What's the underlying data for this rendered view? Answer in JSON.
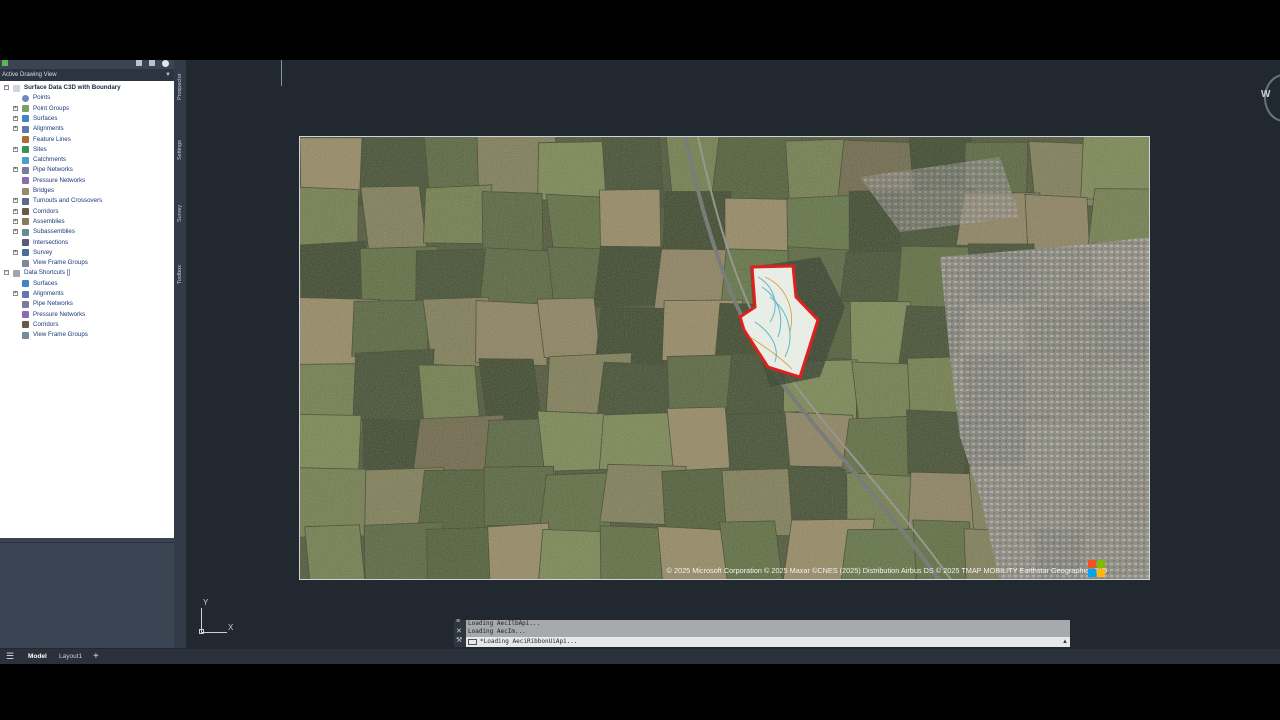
{
  "toolspace": {
    "view_selector": "Active Drawing View",
    "tree": [
      {
        "label": "Surface Data C3D with Boundary",
        "level": 0,
        "expander": "−",
        "icon": "drawing-icon",
        "bold": true
      },
      {
        "label": "Points",
        "level": 1,
        "expander": "",
        "icon": "points-icon"
      },
      {
        "label": "Point Groups",
        "level": 1,
        "expander": "+",
        "icon": "point-groups-icon"
      },
      {
        "label": "Surfaces",
        "level": 1,
        "expander": "+",
        "icon": "surfaces-icon"
      },
      {
        "label": "Alignments",
        "level": 1,
        "expander": "+",
        "icon": "alignments-icon"
      },
      {
        "label": "Feature Lines",
        "level": 1,
        "expander": "",
        "icon": "feature-lines-icon"
      },
      {
        "label": "Sites",
        "level": 1,
        "expander": "+",
        "icon": "sites-icon"
      },
      {
        "label": "Catchments",
        "level": 1,
        "expander": "",
        "icon": "catchments-icon"
      },
      {
        "label": "Pipe Networks",
        "level": 1,
        "expander": "+",
        "icon": "pipe-networks-icon"
      },
      {
        "label": "Pressure Networks",
        "level": 1,
        "expander": "",
        "icon": "pressure-networks-icon"
      },
      {
        "label": "Bridges",
        "level": 1,
        "expander": "",
        "icon": "bridges-icon"
      },
      {
        "label": "Turnouts and Crossovers",
        "level": 1,
        "expander": "+",
        "icon": "turnouts-icon"
      },
      {
        "label": "Corridors",
        "level": 1,
        "expander": "+",
        "icon": "corridors-icon"
      },
      {
        "label": "Assemblies",
        "level": 1,
        "expander": "+",
        "icon": "assemblies-icon"
      },
      {
        "label": "Subassemblies",
        "level": 1,
        "expander": "+",
        "icon": "subassemblies-icon"
      },
      {
        "label": "Intersections",
        "level": 1,
        "expander": "",
        "icon": "intersections-icon"
      },
      {
        "label": "Survey",
        "level": 1,
        "expander": "+",
        "icon": "survey-icon"
      },
      {
        "label": "View Frame Groups",
        "level": 1,
        "expander": "",
        "icon": "view-frame-groups-icon"
      },
      {
        "label": "Data Shortcuts []",
        "level": 0,
        "expander": "−",
        "icon": "data-shortcuts-icon"
      },
      {
        "label": "Surfaces",
        "level": 1,
        "expander": "",
        "icon": "surfaces-icon"
      },
      {
        "label": "Alignments",
        "level": 1,
        "expander": "+",
        "icon": "alignments-icon"
      },
      {
        "label": "Pipe Networks",
        "level": 1,
        "expander": "",
        "icon": "pipe-networks-icon"
      },
      {
        "label": "Pressure Networks",
        "level": 1,
        "expander": "",
        "icon": "pressure-networks-icon"
      },
      {
        "label": "Corridors",
        "level": 1,
        "expander": "",
        "icon": "corridors-icon"
      },
      {
        "label": "View Frame Groups",
        "level": 1,
        "expander": "",
        "icon": "view-frame-groups-icon"
      }
    ],
    "side_tabs": [
      "Prospector",
      "Settings",
      "Survey",
      "Toolbox"
    ]
  },
  "viewcube": {
    "label": "W"
  },
  "map": {
    "attribution": "© 2025 Microsoft Corporation © 2025 Maxar ©CNES (2025) Distribution Airbus DS © 2025 TMAP MOBILITY Earthstar Geographics  SIO",
    "boundary_color": "#e0201e",
    "logo_colors": [
      "#f25022",
      "#7fba00",
      "#00a4ef",
      "#ffb900"
    ]
  },
  "ucs": {
    "y_label": "Y",
    "x_label": "X"
  },
  "command_line": {
    "history": [
      "Loading AecIlbApi...",
      "Loading AecIm..."
    ],
    "input": "*Loading AeciRibbonUiApi..."
  },
  "status_bar": {
    "menu_icon": "hamburger-icon",
    "tabs": [
      "Model",
      "Layout1"
    ],
    "active_tab": "Model",
    "add_icon": "plus-icon"
  }
}
